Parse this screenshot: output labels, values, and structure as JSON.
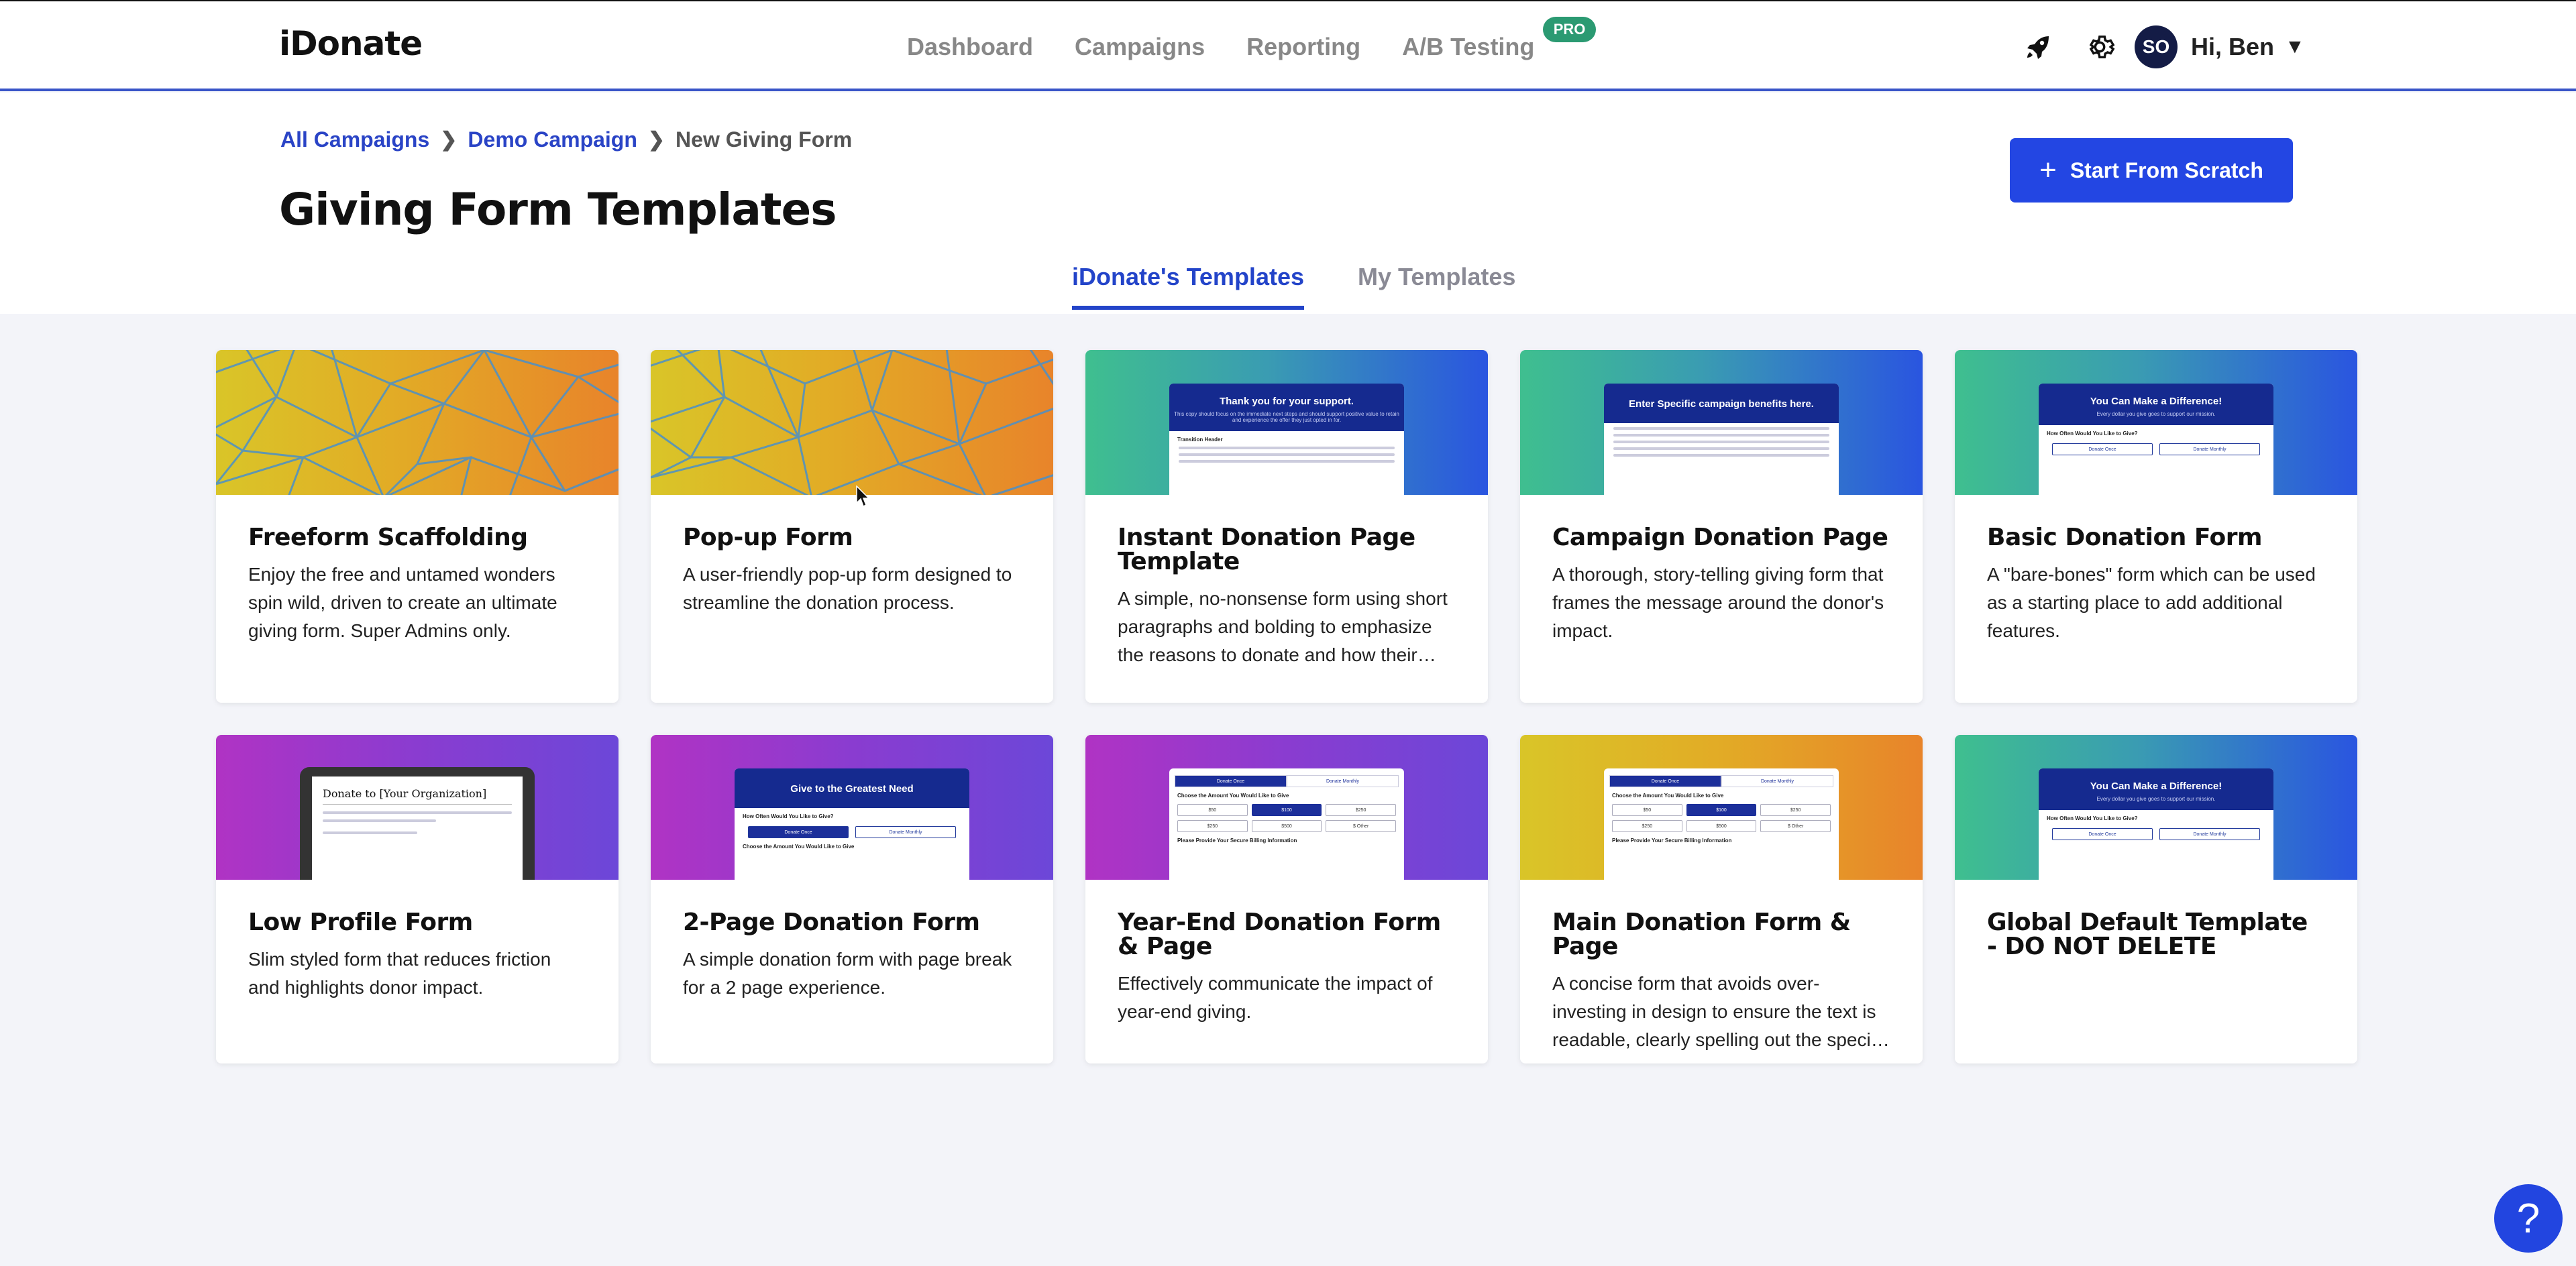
{
  "nav": {
    "logo": "iDonate",
    "links": [
      "Dashboard",
      "Campaigns",
      "Reporting",
      "A/B Testing"
    ],
    "pro_badge": "PRO",
    "avatar_initials": "SO",
    "greeting": "Hi, Ben"
  },
  "breadcrumb": {
    "items": [
      "All Campaigns",
      "Demo Campaign"
    ],
    "current": "New Giving Form"
  },
  "page": {
    "title": "Giving Form Templates",
    "scratch_button": "Start From Scratch"
  },
  "tabs": [
    {
      "label": "iDonate's Templates",
      "active": true
    },
    {
      "label": "My Templates",
      "active": false
    }
  ],
  "templates": [
    {
      "title": "Freeform Scaffolding",
      "desc": "Enjoy the free and untamed wonders spin wild, driven to create an ultimate giving form. Super Admins only."
    },
    {
      "title": "Pop-up Form",
      "desc": "A user-friendly pop-up form designed to streamline the donation process."
    },
    {
      "title": "Instant Donation Page Template",
      "desc": "A simple, no-nonsense form using short paragraphs and bolding to emphasize the reasons to donate and how their donation will be used."
    },
    {
      "title": "Campaign Donation Page",
      "desc": "A thorough, story-telling giving form that frames the message around the donor's impact."
    },
    {
      "title": "Basic Donation Form",
      "desc": "A \"bare-bones\" form which can be used as a starting place to add additional features."
    },
    {
      "title": "Low Profile Form",
      "desc": "Slim styled form that reduces friction and highlights donor impact."
    },
    {
      "title": "2-Page Donation Form",
      "desc": "A simple donation form with page break for a 2 page experience."
    },
    {
      "title": "Year-End Donation Form & Page",
      "desc": "Effectively communicate the impact of year-end giving."
    },
    {
      "title": "Main Donation Form & Page",
      "desc": "A concise form that avoids over-investing in design to ensure the text is readable, clearly spelling out the specific impact of the donation."
    },
    {
      "title": "Global Default Template - DO NOT DELETE",
      "desc": ""
    }
  ],
  "thumbs": {
    "instant_head": "Thank you for your support.",
    "instant_sub": "This copy should focus on the immediate next steps and should support positive value to retain and experience the offer they just opted in for.",
    "instant_h2": "Transition Header",
    "campaign_head": "Enter Specific campaign benefits here.",
    "basic_head": "You Can Make a Difference!",
    "basic_sub": "Every dollar you give goes to support our mission.",
    "basic_q": "How Often Would You Like to Give?",
    "donate_once": "Donate Once",
    "donate_monthly": "Donate Monthly",
    "lowprofile_head": "Donate to [Your Organization]",
    "twopage_head": "Give to the Greatest Need",
    "choose_amount": "Choose the Amount You Would Like to Give",
    "amounts": [
      "$50",
      "$100",
      "$250",
      "$250",
      "$500",
      "$ Other"
    ],
    "billing": "Please Provide Your Secure Billing Information"
  },
  "colors": {
    "accent": "#2346e3",
    "brand_dark": "#152a8f",
    "pro": "#2b9a72"
  }
}
